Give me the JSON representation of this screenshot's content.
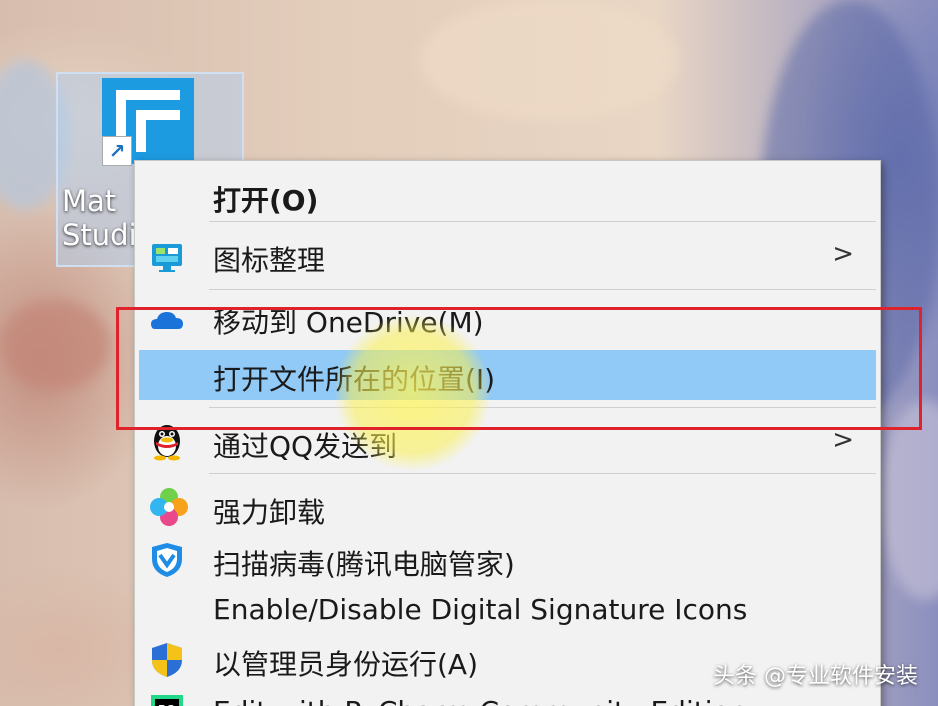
{
  "desktop": {
    "shortcut": {
      "label_line1": "Mat",
      "label_line2": "Studi",
      "icon": "app-icon",
      "overlay_icon": "shortcut-arrow-icon"
    }
  },
  "context_menu": {
    "items": [
      {
        "label": "打开(O)",
        "icon": null,
        "bold": true,
        "submenu": false
      },
      {
        "label": "图标整理",
        "icon": "desktop-organizer-icon",
        "submenu": true,
        "arrow": ">"
      },
      {
        "label": "移动到 OneDrive(M)",
        "icon": "onedrive-cloud-icon",
        "submenu": false
      },
      {
        "label": "打开文件所在的位置(I)",
        "icon": null,
        "submenu": false,
        "highlighted": true
      },
      {
        "label": "通过QQ发送到",
        "icon": "qq-penguin-icon",
        "submenu": true,
        "arrow": ">"
      },
      {
        "label": "强力卸载",
        "icon": "uninstall-flower-icon",
        "submenu": false
      },
      {
        "label": "扫描病毒(腾讯电脑管家)",
        "icon": "tencent-shield-icon",
        "submenu": false
      },
      {
        "label": "Enable/Disable Digital Signature Icons",
        "icon": null,
        "submenu": false
      },
      {
        "label": "以管理员身份运行(A)",
        "icon": "uac-shield-icon",
        "submenu": false
      },
      {
        "label": "Edit with PyCharm Community Edition",
        "icon": "pycharm-icon",
        "submenu": false
      }
    ]
  },
  "watermark": "头条 @专业软件安装",
  "colors": {
    "highlight": "#91c9f7",
    "annotation": "#e0222a",
    "menu_bg": "#f2f2f2"
  }
}
